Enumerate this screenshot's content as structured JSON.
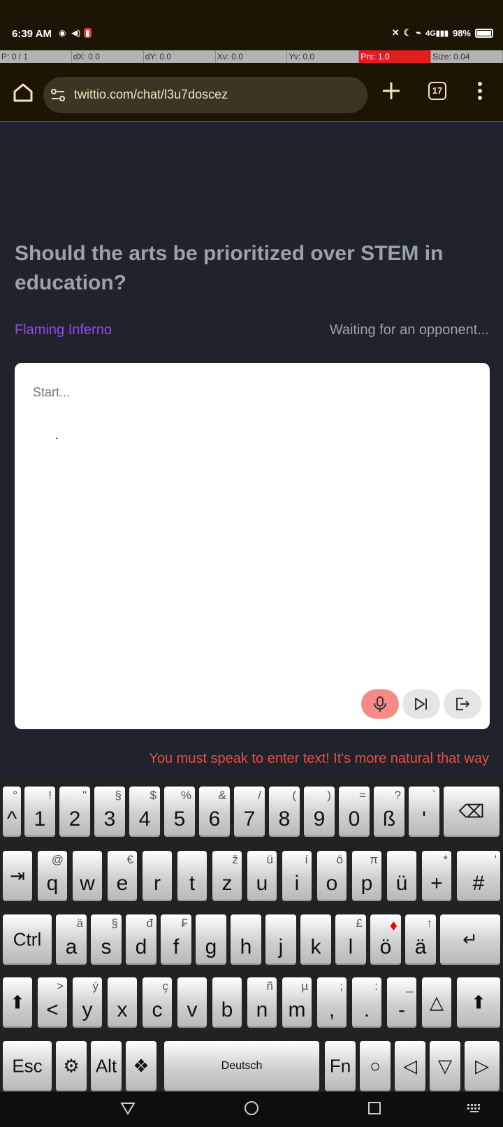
{
  "status": {
    "time": "6:39 AM",
    "battery": "98%"
  },
  "pointer": [
    "P: 0 / 1",
    "dX: 0.0",
    "dY: 0.0",
    "Xv: 0.0",
    "Yv: 0.0",
    "Prs: 1.0",
    "Size: 0.04"
  ],
  "browser": {
    "url": "twittio.com/chat/l3u7doscez",
    "tab_count": "17"
  },
  "page": {
    "question": "Should the arts be prioritized over STEM in education?",
    "username": "Flaming Inferno",
    "status": "Waiting for an opponent...",
    "placeholder": "Start...",
    "warning": "You must speak to enter text! It's more natural that way"
  },
  "keyboard": {
    "row1": [
      {
        "m": "^",
        "s": "°"
      },
      {
        "m": "1",
        "s": "!"
      },
      {
        "m": "2",
        "s": "\""
      },
      {
        "m": "3",
        "s": "§"
      },
      {
        "m": "4",
        "s": "$"
      },
      {
        "m": "5",
        "s": "%"
      },
      {
        "m": "6",
        "s": "&"
      },
      {
        "m": "7",
        "s": "/"
      },
      {
        "m": "8",
        "s": "("
      },
      {
        "m": "9",
        "s": ")"
      },
      {
        "m": "0",
        "s": "="
      },
      {
        "m": "ß",
        "s": "?"
      },
      {
        "m": "'",
        "s": "`"
      },
      {
        "m": "⌫",
        "s": ""
      }
    ],
    "row2": [
      {
        "m": "⇥",
        "s": ""
      },
      {
        "m": "q",
        "s": "@"
      },
      {
        "m": "w",
        "s": ""
      },
      {
        "m": "e",
        "s": "€"
      },
      {
        "m": "r",
        "s": ""
      },
      {
        "m": "t",
        "s": ""
      },
      {
        "m": "z",
        "s": "ž"
      },
      {
        "m": "u",
        "s": "ü"
      },
      {
        "m": "i",
        "s": "í"
      },
      {
        "m": "o",
        "s": "ö"
      },
      {
        "m": "p",
        "s": "π"
      },
      {
        "m": "ü",
        "s": ""
      },
      {
        "m": "+",
        "s": "*"
      },
      {
        "m": "#",
        "s": "'"
      }
    ],
    "row3": [
      {
        "m": "Ctrl",
        "s": ""
      },
      {
        "m": "a",
        "s": "ä"
      },
      {
        "m": "s",
        "s": "§"
      },
      {
        "m": "d",
        "s": "đ"
      },
      {
        "m": "f",
        "s": "₣"
      },
      {
        "m": "g",
        "s": ""
      },
      {
        "m": "h",
        "s": ""
      },
      {
        "m": "j",
        "s": ""
      },
      {
        "m": "k",
        "s": ""
      },
      {
        "m": "l",
        "s": "£"
      },
      {
        "m": "ö",
        "s": "♦"
      },
      {
        "m": "ä",
        "s": "↑"
      },
      {
        "m": "↵",
        "s": ""
      }
    ],
    "row4": [
      {
        "m": "⬆",
        "s": ""
      },
      {
        "m": "<",
        "s": ">"
      },
      {
        "m": "y",
        "s": "ý"
      },
      {
        "m": "x",
        "s": ""
      },
      {
        "m": "c",
        "s": "ç"
      },
      {
        "m": "v",
        "s": ""
      },
      {
        "m": "b",
        "s": ""
      },
      {
        "m": "n",
        "s": "ñ"
      },
      {
        "m": "m",
        "s": "µ"
      },
      {
        "m": ",",
        "s": ";"
      },
      {
        "m": ".",
        "s": ":"
      },
      {
        "m": "-",
        "s": "_"
      },
      {
        "m": "△",
        "s": ""
      },
      {
        "m": "⬆",
        "s": ""
      }
    ],
    "row5": [
      {
        "m": "Esc",
        "s": ""
      },
      {
        "m": "⚙",
        "s": ""
      },
      {
        "m": "Alt",
        "s": ""
      },
      {
        "m": "❖",
        "s": ""
      },
      {
        "m": "Deutsch",
        "s": ""
      },
      {
        "m": "Fn",
        "s": ""
      },
      {
        "m": "○",
        "s": ""
      },
      {
        "m": "◁",
        "s": ""
      },
      {
        "m": "▽",
        "s": ""
      },
      {
        "m": "▷",
        "s": ""
      }
    ]
  }
}
